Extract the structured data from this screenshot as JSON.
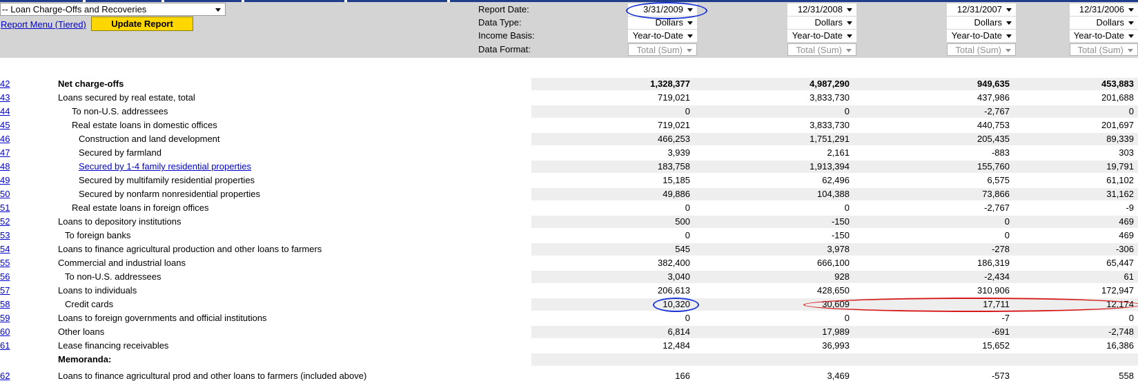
{
  "report_select": {
    "value": "-- Loan Charge-Offs and Recoveries"
  },
  "report_menu_link": "Report Menu (Tiered)",
  "update_button": "Update Report",
  "control_labels": {
    "report_date": "Report Date:",
    "data_type": "Data Type:",
    "income_basis": "Income Basis:",
    "data_format": "Data Format:"
  },
  "columns": [
    {
      "report_date": "3/31/2009",
      "data_type": "Dollars",
      "income_basis": "Year-to-Date",
      "data_format": "Total (Sum)"
    },
    {
      "report_date": "12/31/2008",
      "data_type": "Dollars",
      "income_basis": "Year-to-Date",
      "data_format": "Total (Sum)"
    },
    {
      "report_date": "12/31/2007",
      "data_type": "Dollars",
      "income_basis": "Year-to-Date",
      "data_format": "Total (Sum)"
    },
    {
      "report_date": "12/31/2006",
      "data_type": "Dollars",
      "income_basis": "Year-to-Date",
      "data_format": "Total (Sum)"
    }
  ],
  "rows": [
    {
      "num": "42",
      "label": "Net charge-offs",
      "indent": 0,
      "bold": true,
      "values": [
        "1,328,377",
        "4,987,290",
        "949,635",
        "453,883"
      ]
    },
    {
      "num": "43",
      "label": "Loans secured by real estate, total",
      "indent": 0,
      "values": [
        "719,021",
        "3,833,730",
        "437,986",
        "201,688"
      ]
    },
    {
      "num": "44",
      "label": "To non-U.S. addressees",
      "indent": 2,
      "values": [
        "0",
        "0",
        "-2,767",
        "0"
      ]
    },
    {
      "num": "45",
      "label": "Real estate loans in domestic offices",
      "indent": 2,
      "values": [
        "719,021",
        "3,833,730",
        "440,753",
        "201,697"
      ]
    },
    {
      "num": "46",
      "label": "Construction and land development",
      "indent": 3,
      "values": [
        "466,253",
        "1,751,291",
        "205,435",
        "89,339"
      ]
    },
    {
      "num": "47",
      "label": "Secured by farmland",
      "indent": 3,
      "values": [
        "3,939",
        "2,161",
        "-883",
        "303"
      ]
    },
    {
      "num": "48",
      "label": "Secured by 1-4 family residential properties",
      "indent": 3,
      "link": true,
      "values": [
        "183,758",
        "1,913,394",
        "155,760",
        "19,791"
      ]
    },
    {
      "num": "49",
      "label": "Secured by multifamily residential properties",
      "indent": 3,
      "values": [
        "15,185",
        "62,496",
        "6,575",
        "61,102"
      ]
    },
    {
      "num": "50",
      "label": "Secured by nonfarm nonresidential properties",
      "indent": 3,
      "values": [
        "49,886",
        "104,388",
        "73,866",
        "31,162"
      ]
    },
    {
      "num": "51",
      "label": "Real estate loans in foreign offices",
      "indent": 2,
      "values": [
        "0",
        "0",
        "-2,767",
        "-9"
      ]
    },
    {
      "num": "52",
      "label": "Loans to depository institutions",
      "indent": 0,
      "values": [
        "500",
        "-150",
        "0",
        "469"
      ]
    },
    {
      "num": "53",
      "label": "To foreign banks",
      "indent": 1,
      "values": [
        "0",
        "-150",
        "0",
        "469"
      ]
    },
    {
      "num": "54",
      "label": "Loans to finance agricultural production and other loans to farmers",
      "indent": 0,
      "values": [
        "545",
        "3,978",
        "-278",
        "-306"
      ]
    },
    {
      "num": "55",
      "label": "Commercial and industrial loans",
      "indent": 0,
      "values": [
        "382,400",
        "666,100",
        "186,319",
        "65,447"
      ]
    },
    {
      "num": "56",
      "label": "To non-U.S. addressees",
      "indent": 1,
      "values": [
        "3,040",
        "928",
        "-2,434",
        "61"
      ]
    },
    {
      "num": "57",
      "label": "Loans to individuals",
      "indent": 0,
      "values": [
        "206,613",
        "428,650",
        "310,906",
        "172,947"
      ]
    },
    {
      "num": "58",
      "label": "Credit cards",
      "indent": 1,
      "values": [
        "10,320",
        "30,609",
        "17,711",
        "12,174"
      ]
    },
    {
      "num": "59",
      "label": "Loans to foreign governments and official institutions",
      "indent": 0,
      "values": [
        "0",
        "0",
        "-7",
        "0"
      ]
    },
    {
      "num": "60",
      "label": "Other loans",
      "indent": 0,
      "values": [
        "6,814",
        "17,989",
        "-691",
        "-2,748"
      ]
    },
    {
      "num": "61",
      "label": "Lease financing receivables",
      "indent": 0,
      "values": [
        "12,484",
        "36,993",
        "15,652",
        "16,386"
      ]
    },
    {
      "num": "",
      "label": "Memoranda:",
      "indent": 0,
      "bold": true,
      "values": []
    },
    {
      "num": "62",
      "label": "Loans to finance agricultural prod and other loans to farmers (included above)",
      "indent": 0,
      "values": [
        "166",
        "3,469",
        "-573",
        "558"
      ]
    }
  ],
  "annotation_colors": {
    "blue": "#1a35d6",
    "red": "#d81818"
  }
}
